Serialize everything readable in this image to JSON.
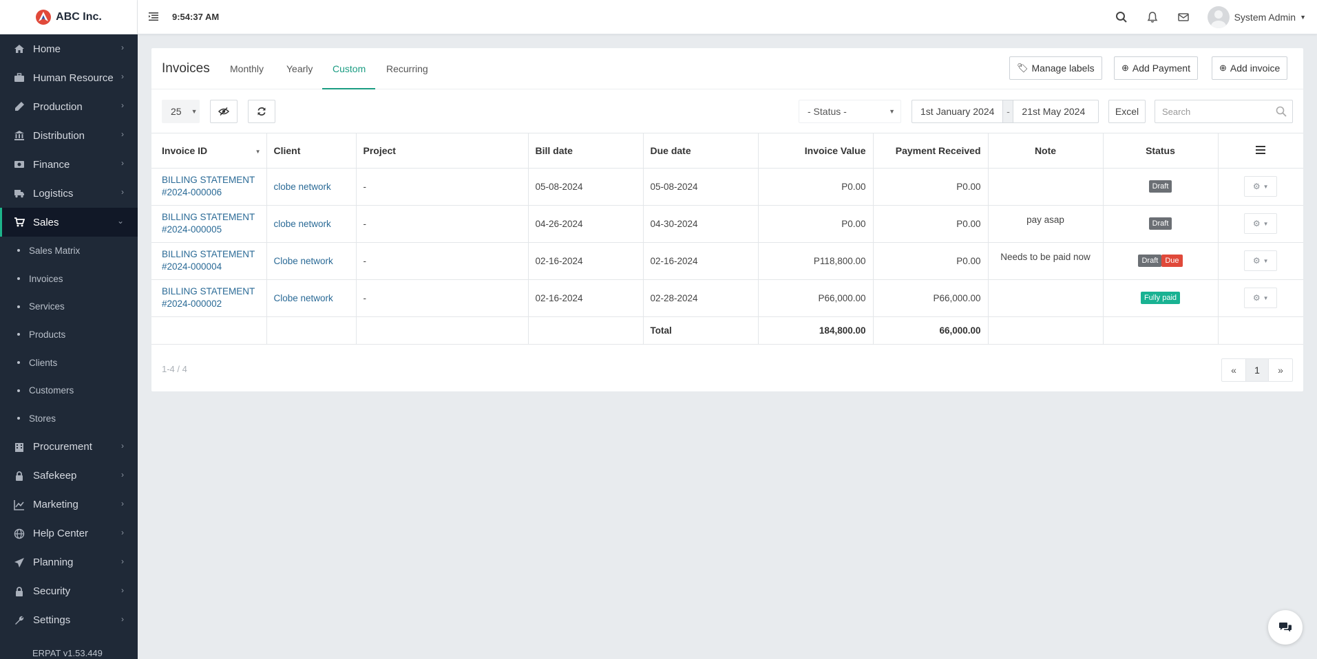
{
  "brand": {
    "name": "ABC Inc."
  },
  "topbar": {
    "time": "9:54:37 AM",
    "user_name": "System Admin"
  },
  "sidebar": {
    "items": [
      {
        "label": "Home",
        "icon": "home-icon"
      },
      {
        "label": "Human Resource",
        "icon": "briefcase-icon"
      },
      {
        "label": "Production",
        "icon": "flask-icon"
      },
      {
        "label": "Distribution",
        "icon": "bank-icon"
      },
      {
        "label": "Finance",
        "icon": "money-icon"
      },
      {
        "label": "Logistics",
        "icon": "truck-icon"
      },
      {
        "label": "Sales",
        "icon": "cart-icon"
      }
    ],
    "sales_sub": [
      "Sales Matrix",
      "Invoices",
      "Services",
      "Products",
      "Clients",
      "Customers",
      "Stores"
    ],
    "items_after": [
      {
        "label": "Procurement",
        "icon": "building-icon"
      },
      {
        "label": "Safekeep",
        "icon": "lock-icon"
      },
      {
        "label": "Marketing",
        "icon": "chart-icon"
      },
      {
        "label": "Help Center",
        "icon": "globe-icon"
      },
      {
        "label": "Planning",
        "icon": "plane-icon"
      },
      {
        "label": "Security",
        "icon": "lock-icon"
      },
      {
        "label": "Settings",
        "icon": "wrench-icon"
      }
    ],
    "version": "ERPAT v1.53.449"
  },
  "card": {
    "title": "Invoices",
    "tabs": [
      "Monthly",
      "Yearly",
      "Custom",
      "Recurring"
    ],
    "active_tab": "Custom",
    "buttons": {
      "manage_labels": "Manage labels",
      "add_payment": "Add Payment",
      "add_invoice": "Add invoice"
    }
  },
  "toolbar": {
    "page_size": "25",
    "status_placeholder": "- Status -",
    "date_from": "1st January 2024",
    "date_sep": "-",
    "date_to": "21st May 2024",
    "excel": "Excel",
    "search_placeholder": "Search"
  },
  "table": {
    "headers": [
      "Invoice ID",
      "Client",
      "Project",
      "Bill date",
      "Due date",
      "Invoice Value",
      "Payment Received",
      "Note",
      "Status"
    ],
    "rows": [
      {
        "id_line1": "BILLING STATEMENT",
        "id_line2": "#2024-000006",
        "client": "clobe network",
        "project": "-",
        "bill_date": "05-08-2024",
        "due_date": "05-08-2024",
        "value": "P0.00",
        "received": "P0.00",
        "note": "",
        "status": [
          "Draft"
        ]
      },
      {
        "id_line1": "BILLING STATEMENT",
        "id_line2": "#2024-000005",
        "client": "clobe network",
        "project": "-",
        "bill_date": "04-26-2024",
        "due_date": "04-30-2024",
        "value": "P0.00",
        "received": "P0.00",
        "note": "pay asap",
        "status": [
          "Draft"
        ]
      },
      {
        "id_line1": "BILLING STATEMENT",
        "id_line2": "#2024-000004",
        "client": "Clobe network",
        "project": "-",
        "bill_date": "02-16-2024",
        "due_date": "02-16-2024",
        "value": "P118,800.00",
        "received": "P0.00",
        "note": "Needs to be paid now",
        "status": [
          "Draft",
          "Due"
        ]
      },
      {
        "id_line1": "BILLING STATEMENT",
        "id_line2": "#2024-000002",
        "client": "Clobe network",
        "project": "-",
        "bill_date": "02-16-2024",
        "due_date": "02-28-2024",
        "value": "P66,000.00",
        "received": "P66,000.00",
        "note": "",
        "status": [
          "Fully paid"
        ]
      }
    ],
    "total_label": "Total",
    "total_value": "184,800.00",
    "total_received": "66,000.00"
  },
  "footer": {
    "range": "1-4 / 4",
    "page": "1",
    "prev": "«",
    "next": "»"
  },
  "colors": {
    "sidebar_bg": "#1f2937",
    "accent": "#1a9c82",
    "link": "#2a6a96",
    "draft": "#6b6f74",
    "due": "#e0493a",
    "paid": "#19b292"
  }
}
